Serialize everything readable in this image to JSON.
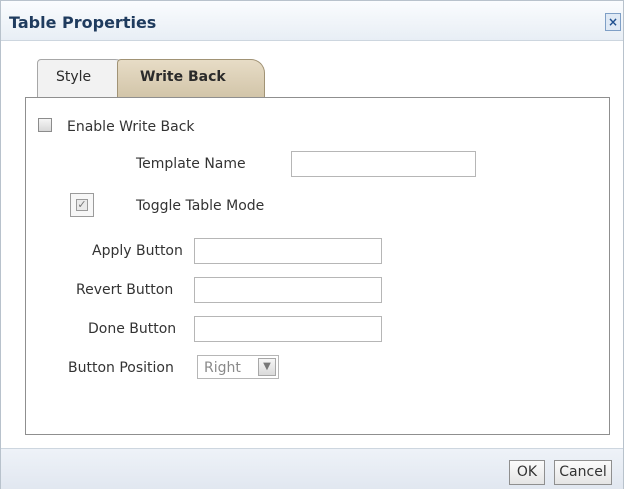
{
  "dialog": {
    "title": "Table Properties",
    "close_label": "×"
  },
  "tabs": [
    {
      "label": "Style",
      "selected": false
    },
    {
      "label": "Write Back",
      "selected": true
    }
  ],
  "form": {
    "enable_write_back": {
      "label": "Enable Write Back",
      "checked": false
    },
    "template_name": {
      "label": "Template Name",
      "value": ""
    },
    "toggle_table_mode": {
      "label": "Toggle Table Mode",
      "checked": true
    },
    "apply_button": {
      "label": "Apply Button",
      "value": ""
    },
    "revert_button": {
      "label": "Revert Button",
      "value": ""
    },
    "done_button": {
      "label": "Done Button",
      "value": ""
    },
    "button_position": {
      "label": "Button Position",
      "value": "Right"
    }
  },
  "footer": {
    "ok_label": "OK",
    "cancel_label": "Cancel"
  },
  "colors": {
    "title": "#1f3b5e",
    "selected_tab": "#d9cdb3",
    "panel_border": "#8f8f8f"
  }
}
